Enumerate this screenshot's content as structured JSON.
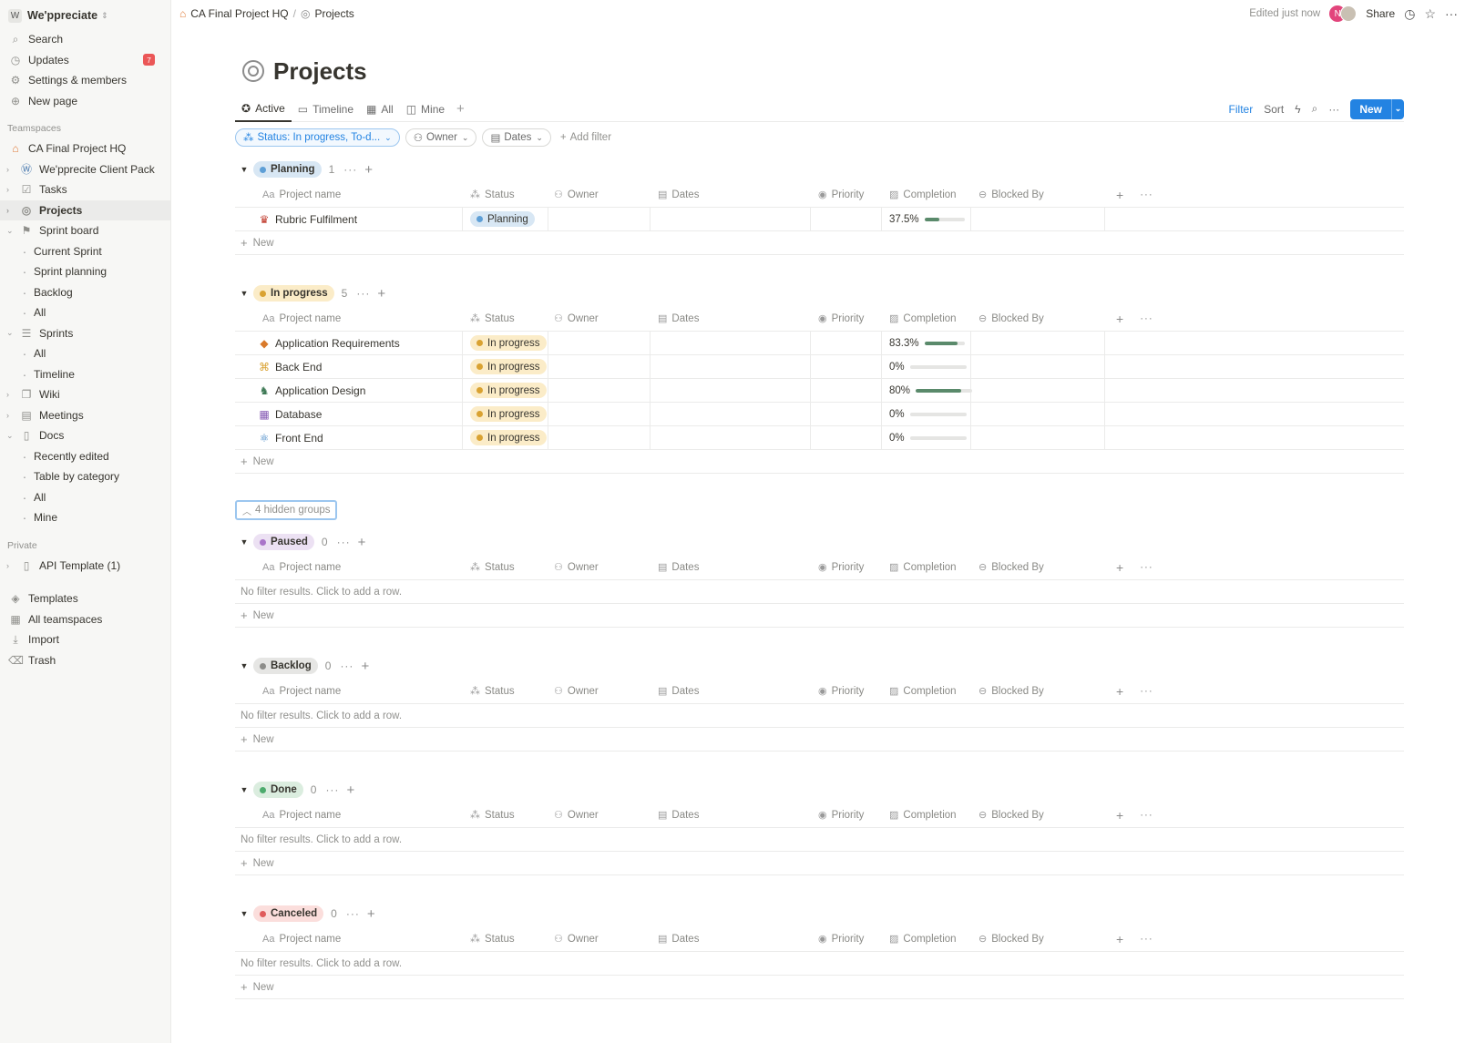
{
  "workspace": {
    "logo": "W",
    "name": "We'ppreciate"
  },
  "sidebar": {
    "top": [
      {
        "label": "Search",
        "icon": "search-icon",
        "glyph": "⌕"
      },
      {
        "label": "Updates",
        "icon": "clock-icon",
        "glyph": "◷",
        "badge": "7"
      },
      {
        "label": "Settings & members",
        "icon": "gear-icon",
        "glyph": "⚙"
      },
      {
        "label": "New page",
        "icon": "plus-circle-icon",
        "glyph": "⊕"
      }
    ],
    "teamspaces_heading": "Teamspaces",
    "teamspaces": [
      {
        "label": "CA Final Project HQ",
        "icon": "home-icon",
        "glyph": "⌂"
      },
      {
        "label": "We'pprecite Client Pack",
        "icon": "w-logo-icon",
        "glyph": "Ⓦ"
      },
      {
        "label": "Tasks",
        "icon": "checkbox-icon",
        "glyph": "☑"
      },
      {
        "label": "Projects",
        "icon": "target-icon",
        "glyph": "◎"
      },
      {
        "label": "Sprint board",
        "icon": "runner-icon",
        "glyph": "⚑"
      },
      {
        "label": "Current Sprint"
      },
      {
        "label": "Sprint planning"
      },
      {
        "label": "Backlog"
      },
      {
        "label": "All"
      },
      {
        "label": "Sprints",
        "icon": "stack-icon",
        "glyph": "☰"
      },
      {
        "label": "All"
      },
      {
        "label": "Timeline"
      },
      {
        "label": "Wiki",
        "icon": "book-icon",
        "glyph": "❐"
      },
      {
        "label": "Meetings",
        "icon": "calendar-icon",
        "glyph": "▤"
      },
      {
        "label": "Docs",
        "icon": "document-icon",
        "glyph": "▯"
      },
      {
        "label": "Recently edited"
      },
      {
        "label": "Table by category"
      },
      {
        "label": "All"
      },
      {
        "label": "Mine"
      }
    ],
    "private_heading": "Private",
    "private": [
      {
        "label": "API Template (1)",
        "icon": "page-icon",
        "glyph": "▯"
      }
    ],
    "bottom": [
      {
        "label": "Templates",
        "icon": "shapes-icon",
        "glyph": "◈"
      },
      {
        "label": "All teamspaces",
        "icon": "grid-icon",
        "glyph": "▦"
      },
      {
        "label": "Import",
        "icon": "download-icon",
        "glyph": "⤓"
      },
      {
        "label": "Trash",
        "icon": "trash-icon",
        "glyph": "🗑"
      }
    ]
  },
  "topbar": {
    "breadcrumb": [
      "CA Final Project HQ",
      "Projects"
    ],
    "edited": "Edited just now",
    "avatar_initial": "N",
    "share": "Share"
  },
  "page": {
    "title": "Projects",
    "views": [
      "Active",
      "Timeline",
      "All",
      "Mine"
    ],
    "tools": {
      "filter": "Filter",
      "sort": "Sort",
      "new": "New"
    },
    "filters": {
      "status": "Status: In progress, To-d...",
      "owner": "Owner",
      "dates": "Dates",
      "add": "Add filter"
    },
    "columns": [
      "Project name",
      "Status",
      "Owner",
      "Dates",
      "Priority",
      "Completion",
      "Blocked By"
    ],
    "new_row": "New",
    "empty_text": "No filter results. Click to add a row.",
    "hidden_groups": "4 hidden groups"
  },
  "groups": {
    "planning": {
      "label": "Planning",
      "count": "1",
      "color": "#5e9fd6",
      "bg": "#d8e7f4",
      "rows": [
        {
          "name": "Rubric Fulfilment",
          "icon": "crown-icon",
          "glyph": "♛",
          "status": "Planning",
          "completion": "37.5%",
          "pct": 37.5
        }
      ]
    },
    "in_progress": {
      "label": "In progress",
      "count": "5",
      "color": "#d9a232",
      "bg": "#fbecc8",
      "rows": [
        {
          "name": "Application Requirements",
          "icon": "tag-icon",
          "glyph": "◆",
          "status": "In progress",
          "completion": "83.3%",
          "pct": 83.3
        },
        {
          "name": "Back End",
          "icon": "command-icon",
          "glyph": "⌘",
          "status": "In progress",
          "completion": "0%",
          "pct": 0
        },
        {
          "name": "Application Design",
          "icon": "elephant-icon",
          "glyph": "♞",
          "status": "In progress",
          "completion": "80%",
          "pct": 80
        },
        {
          "name": "Database",
          "icon": "table-icon",
          "glyph": "▦",
          "status": "In progress",
          "completion": "0%",
          "pct": 0
        },
        {
          "name": "Front End",
          "icon": "atom-icon",
          "glyph": "⚛",
          "status": "In progress",
          "completion": "0%",
          "pct": 0
        }
      ]
    },
    "paused": {
      "label": "Paused",
      "count": "0",
      "color": "#a974c9",
      "bg": "#ece1f3"
    },
    "backlog": {
      "label": "Backlog",
      "count": "0",
      "color": "#8d8d8a",
      "bg": "#e6e6e4"
    },
    "done": {
      "label": "Done",
      "count": "0",
      "color": "#4dab6d",
      "bg": "#dbeddf"
    },
    "canceled": {
      "label": "Canceled",
      "count": "0",
      "color": "#e05b5b",
      "bg": "#fbdedc"
    }
  }
}
